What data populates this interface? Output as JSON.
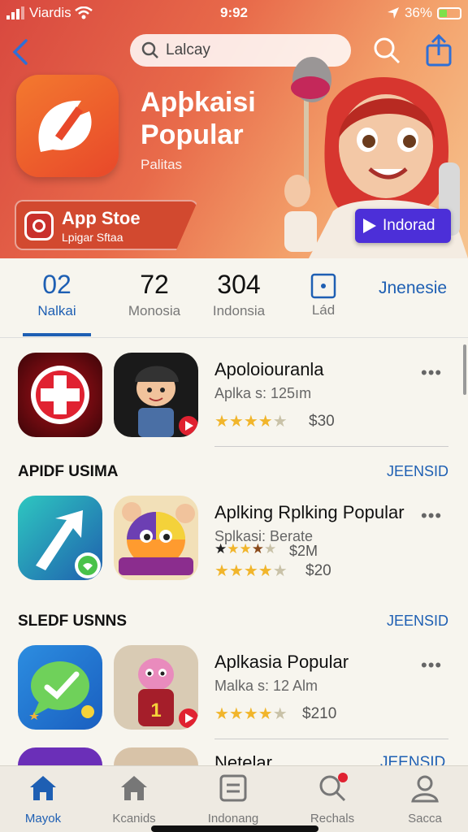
{
  "status": {
    "carrier": "Viardis",
    "time": "9:92",
    "battery": "36%"
  },
  "search": {
    "query": "Lalcay"
  },
  "hero": {
    "title": "Apþkaisi Popular",
    "subtitle": "Palitas",
    "store_title": "App Stoe",
    "store_sub": "Lpigar Sftaa",
    "install_label": "Indorad"
  },
  "stats": [
    {
      "num": "02",
      "label": "Nalkai"
    },
    {
      "num": "72",
      "label": "Monosia"
    },
    {
      "num": "304",
      "label": "Indonsia"
    },
    {
      "num": "",
      "label": "Lád"
    }
  ],
  "stats_link": "Jnenesie",
  "rows": [
    {
      "title": "Apoloiouranla",
      "sub": "Aplka s: 125ım",
      "price": "$30",
      "rating": 4.5
    },
    {
      "title": "Aplking Rplking Popular",
      "sub": "Splkasi: Berate",
      "sub_price": "$2M",
      "price": "$20",
      "rating": 4.5
    },
    {
      "title": "Aplkasia Popular",
      "sub": "Malka s: 12 Alm",
      "price": "$210",
      "rating": 4.5
    },
    {
      "title": "Netelar"
    }
  ],
  "sections": [
    {
      "heading": "APIDF USIMA",
      "action": "JEENSID"
    },
    {
      "heading": "SLEDF USNNS",
      "action": "JEENSID"
    }
  ],
  "partial_row_action": "JEENSID",
  "tabs": [
    {
      "label": "Mayok",
      "icon": "house-icon"
    },
    {
      "label": "Kcanids",
      "icon": "house-icon"
    },
    {
      "label": "Indonang",
      "icon": "list-icon"
    },
    {
      "label": "Rechals",
      "icon": "search-icon"
    },
    {
      "label": "Sacca",
      "icon": "person-icon"
    }
  ],
  "colors": {
    "accent": "#1e5fb3",
    "star": "#f1b52b",
    "install": "#4c2fd8",
    "hero_start": "#d8483f"
  }
}
